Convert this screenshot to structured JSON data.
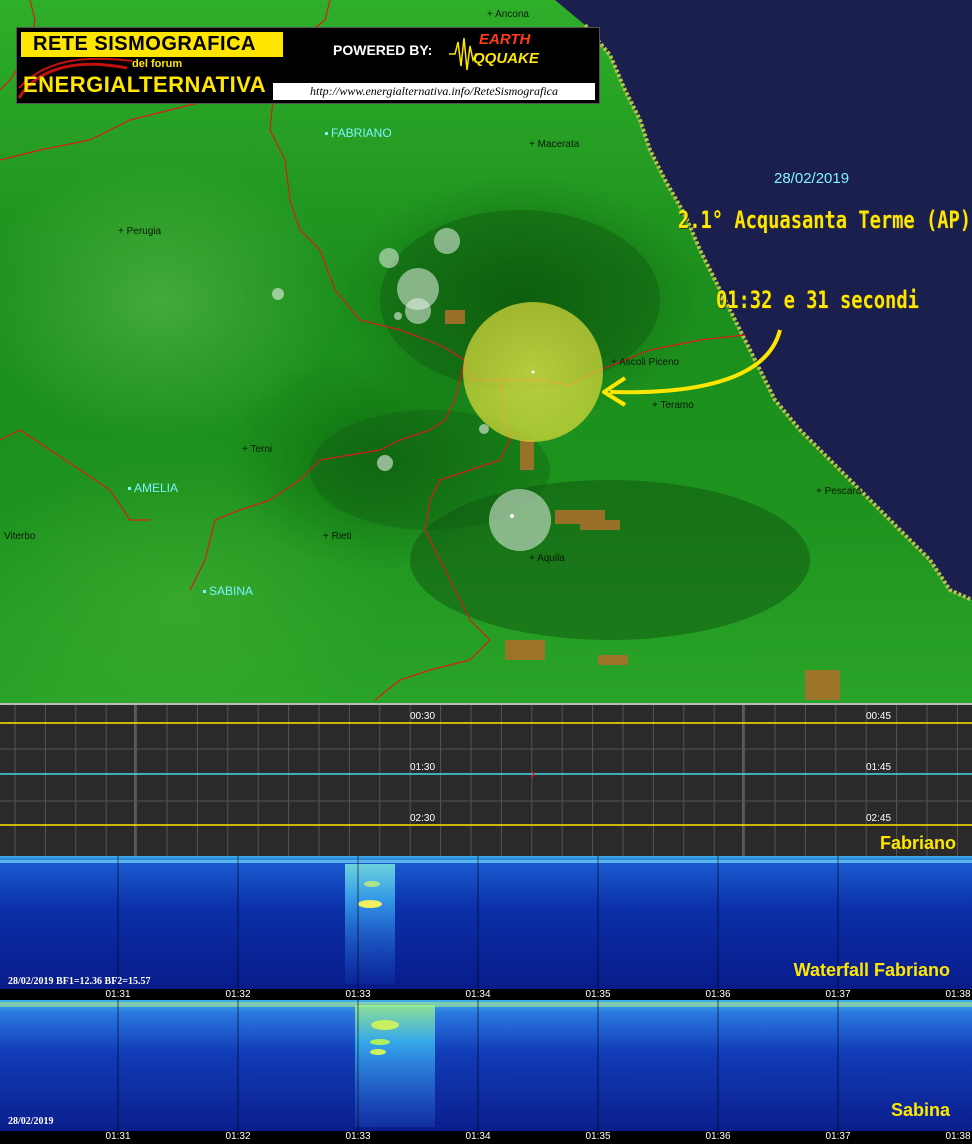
{
  "banner": {
    "line1": "RETE SISMOGRAFICA",
    "line2": "del forum",
    "line3": "ENERGIALTERNATIVA",
    "powered_by": "POWERED BY:",
    "logo_top": "EARTH",
    "logo_bottom": "QQUAKE",
    "url": "http://www.energialternativa.info/ReteSismografica"
  },
  "map": {
    "cities": [
      {
        "name": "+ Ancona"
      },
      {
        "name": "+ Macerata"
      },
      {
        "name": "+ Perugia"
      },
      {
        "name": "+ Ascoli Piceno"
      },
      {
        "name": "+ Teramo"
      },
      {
        "name": "+ Terni"
      },
      {
        "name": "+ Rieti"
      },
      {
        "name": "Viterbo"
      },
      {
        "name": "+ Pescara"
      },
      {
        "name": "+ Aquila"
      }
    ],
    "stations": [
      {
        "name": "FABRIANO"
      },
      {
        "name": "AMELIA"
      },
      {
        "name": "SABINA"
      }
    ],
    "colors": {
      "sea": "#1b1f4e",
      "land": "#1f9a1f",
      "borders": "#d81c1c",
      "quake": "#e8e84a"
    }
  },
  "annotation": {
    "date": "28/02/2019",
    "event": "2.1° Acquasanta Terme (AP)",
    "time": "01:32 e 31 secondi"
  },
  "helicorder": {
    "left_labels": [
      "00:30",
      "01:30",
      "02:30"
    ],
    "right_labels": [
      "00:45",
      "01:45",
      "02:45"
    ],
    "station": "Fabriano"
  },
  "waterfall1": {
    "info": "28/02/2019 BF1=12.36 BF2=15.57",
    "title": "Waterfall Fabriano"
  },
  "waterfall2": {
    "info": "28/02/2019",
    "title": "Sabina"
  },
  "time_axis": [
    "01:31",
    "01:32",
    "01:33",
    "01:34",
    "01:35",
    "01:36",
    "01:37",
    "01:38"
  ]
}
